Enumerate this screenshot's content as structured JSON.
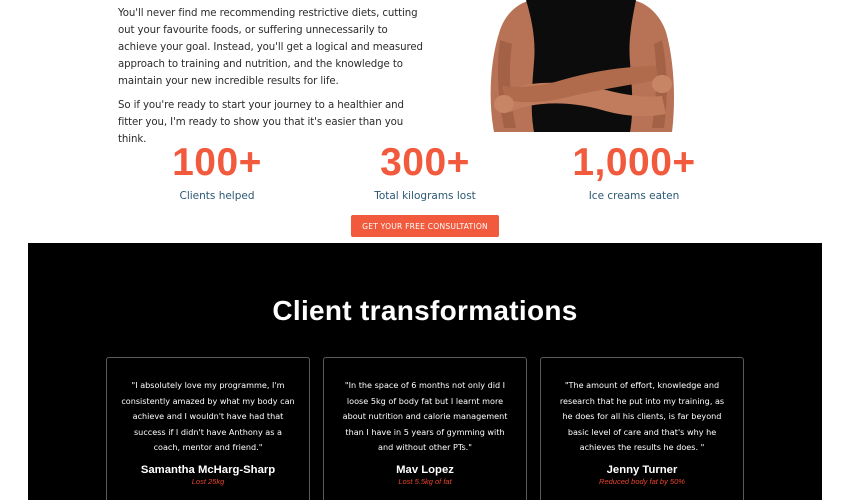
{
  "intro": {
    "paragraph1": "You'll never find me recommending restrictive diets, cutting out your favourite foods, or suffering unnecessarily to achieve your goal. Instead, you'll get a logical and measured approach to training and nutrition, and the knowledge to maintain your new incredible results for life.",
    "paragraph2": "So if you're ready to start your journey to a healthier and fitter you, I'm ready to show you that it's easier than you think."
  },
  "stats": [
    {
      "value": "100+",
      "label": "Clients helped"
    },
    {
      "value": "300+",
      "label": "Total kilograms lost"
    },
    {
      "value": "1,000+",
      "label": "Ice creams eaten"
    }
  ],
  "cta": {
    "label": "Get your free consultation"
  },
  "transformations": {
    "title": "Client transformations",
    "cards": [
      {
        "quote": "\"I absolutely love my programme, I'm consistently amazed by what my body can achieve and I wouldn't have had that success if I didn't have Anthony as a coach, mentor and friend.\"",
        "name": "Samantha McHarg-Sharp",
        "result": "Lost 25kg"
      },
      {
        "quote": "\"In the space of 6 months not only did I loose 5kg of body fat but I learnt more about nutrition and calorie management than I have in 5 years of gymming with and without other PTs.\"",
        "name": "Mav Lopez",
        "result": "Lost 5.5kg of fat"
      },
      {
        "quote": "\"The amount of effort, knowledge and research that he put into my training, as he does for all his clients, is far beyond basic level of care and that's why he achieves the results he does. \"",
        "name": "Jenny Turner",
        "result": "Reduced body fat by 50%"
      }
    ]
  },
  "colors": {
    "accent": "#f15a3c",
    "stat_label": "#2c5873",
    "dark_section": "#000000",
    "result_text": "#e8452d"
  },
  "icons": {
    "hero_image": "trainer-photo"
  }
}
